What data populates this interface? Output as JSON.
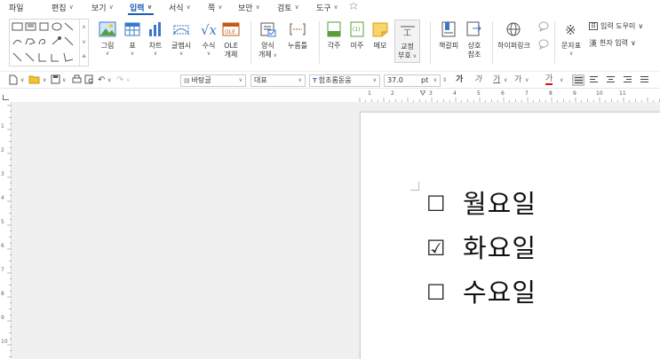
{
  "menu": [
    {
      "label": "파일",
      "chevron": false
    },
    {
      "label": "편집",
      "chevron": true
    },
    {
      "label": "보기",
      "chevron": true
    },
    {
      "label": "입력",
      "chevron": true,
      "active": true
    },
    {
      "label": "서식",
      "chevron": true
    },
    {
      "label": "쪽",
      "chevron": true
    },
    {
      "label": "보안",
      "chevron": true
    },
    {
      "label": "검토",
      "chevron": true
    },
    {
      "label": "도구",
      "chevron": true
    }
  ],
  "ribbon": {
    "picture": "그림",
    "table": "표",
    "chart": "차트",
    "wordart": "글맵시",
    "equation": "수식",
    "ole_line1": "OLE",
    "ole_line2": "개체",
    "form_line1": "양식",
    "form_line2": "개체",
    "pushbutton": "누름틀",
    "footnote": "각주",
    "endnote": "미주",
    "memo": "메모",
    "proof_line1": "교정",
    "proof_line2": "부호",
    "bookmark": "책갈피",
    "crossref_line1": "상호",
    "crossref_line2": "참조",
    "hyperlink": "하이퍼링크",
    "symbol": "문자표",
    "input_helper": "입력 도우미",
    "hanja_input": "한자 입력"
  },
  "format": {
    "style": "바탕글",
    "lang": "대표",
    "font": "함초롬돋움",
    "size": "37.0",
    "unit": "pt",
    "bold": "가",
    "italic": "가",
    "underline": "가",
    "strike": "가",
    "color": "가"
  },
  "ruler": {
    "h_numbers": [
      "1",
      "2",
      "3",
      "4",
      "5",
      "6",
      "7",
      "8",
      "9",
      "10",
      "11"
    ],
    "v_numbers": [
      "1",
      "2",
      "3",
      "4",
      "5",
      "6",
      "7",
      "8",
      "9",
      "10"
    ]
  },
  "document": {
    "items": [
      {
        "label": "월요일",
        "checked": false
      },
      {
        "label": "화요일",
        "checked": true
      },
      {
        "label": "수요일",
        "checked": false
      }
    ],
    "glyph_checked": "☑",
    "glyph_unchecked": "☐"
  },
  "colors": {
    "accent": "#1f5bb5",
    "canvas": "#f0f0f0",
    "page": "#ffffff"
  }
}
